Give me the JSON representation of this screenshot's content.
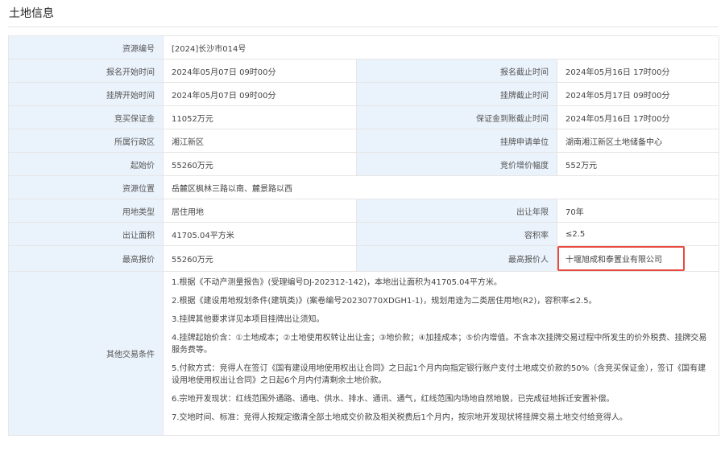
{
  "page": {
    "title": "土地信息"
  },
  "rows": [
    {
      "l1": "资源编号",
      "v1": "[2024]长沙市014号"
    },
    {
      "l1": "报名开始时间",
      "v1": "2024年05月07日 09时00分",
      "l2": "报名截止时间",
      "v2": "2024年05月16日 17时00分"
    },
    {
      "l1": "挂牌开始时间",
      "v1": "2024年05月07日 09时00分",
      "l2": "挂牌截止时间",
      "v2": "2024年05月17日 09时00分"
    },
    {
      "l1": "竞买保证金",
      "v1": "11052万元",
      "l2": "保证金到账截止时间",
      "v2": "2024年05月16日 17时00分"
    },
    {
      "l1": "所属行政区",
      "v1": "湘江新区",
      "l2": "挂牌申请单位",
      "v2": "湖南湘江新区土地储备中心"
    },
    {
      "l1": "起始价",
      "v1": "55260万元",
      "l2": "竞价增价幅度",
      "v2": "552万元"
    },
    {
      "l1": "资源位置",
      "v1": "岳麓区枫林三路以南、麓景路以西"
    },
    {
      "l1": "用地类型",
      "v1": "居住用地",
      "l2": "出让年限",
      "v2": "70年"
    },
    {
      "l1": "出让面积",
      "v1": "41705.04平方米",
      "l2": "容积率",
      "v2": "≤2.5"
    },
    {
      "l1": "最高报价",
      "v1": "55260万元",
      "l2": "最高报价人",
      "v2": "十堰旭成和泰置业有限公司"
    }
  ],
  "other_conditions": {
    "label": "其他交易条件",
    "notes": [
      "1.根据《不动产测量报告》(受理编号DJ-202312-142)，本地出让面积为41705.04平方米。",
      "2.根据《建设用地规划条件(建筑类)》(案卷编号20230770XDGH1-1)，规划用途为二类居住用地(R2)，容积率≤2.5。",
      "3.挂牌其他要求详见本项目挂牌出让须知。",
      "4.挂牌起始价含：①土地成本；②土地使用权转让出让金；③地价款；④加挂成本；⑤价内增值。不含本次挂牌交易过程中所发生的价外税费、挂牌交易服务费等。",
      "5.付款方式：竞得人在签订《国有建设用地使用权出让合同》之日起1个月内向指定银行账户支付土地成交价款的50%（含竞买保证金），签订《国有建设用地使用权出让合同》之日起6个月内付清剩余土地价款。",
      "6.宗地开发现状：红线范围外通路、通电、供水、排水、通讯、通气，红线范围内场地自然地貌，已完成征地拆迁安置补偿。",
      "7.交地时间、标准：竞得人按规定缴清全部土地成交价款及相关税费后1个月内，按宗地开发现状将挂牌交易土地交付给竞得人。"
    ]
  },
  "colors": {
    "label_bg": "#eaf2fb",
    "highlight": "#e84a3f"
  }
}
